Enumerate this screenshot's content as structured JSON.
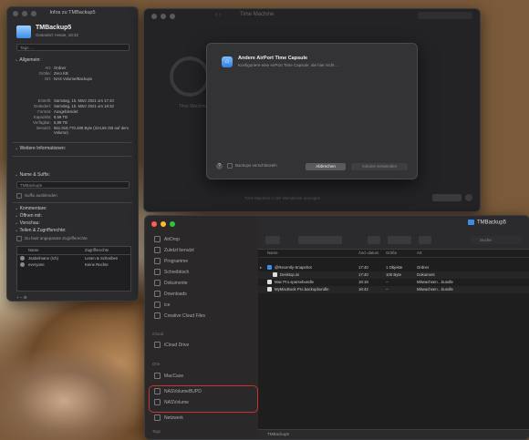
{
  "info": {
    "title": "Infos zu TMBackup5",
    "name": "TMBackup5",
    "subtitle": "Geändert: Heute, 18:32",
    "tags_placeholder": "Tags …",
    "sections": {
      "general": "Allgemein:",
      "more": "Weitere Informationen:",
      "name_ext": "Name & Suffix:",
      "comments": "Kommentare:",
      "open_with": "Öffnen mit:",
      "preview": "Vorschau:",
      "sharing": "Teilen & Zugriffsrechte:"
    },
    "kv": [
      {
        "k": "Art:",
        "v": "Ordner"
      },
      {
        "k": "Größe:",
        "v": "Zero KB"
      },
      {
        "k": "Ort:",
        "v": "NAS Volume/Backups"
      },
      {
        "k": "Erstellt:",
        "v": "Samstag, 15. März 2021 um 17:40"
      },
      {
        "k": "Geändert:",
        "v": "Samstag, 15. März 2021 um 18:32"
      },
      {
        "k": "Format:",
        "v": "Ausgeblendet"
      },
      {
        "k": "Kapazität:",
        "v": "8,58 TB"
      },
      {
        "k": "Verfügbar:",
        "v": "6,89 TB"
      },
      {
        "k": "Benutzt:",
        "v": "551.918.770.488 Byte (324,65 GB auf dem Volume)"
      }
    ],
    "name_value": "TMBackup5",
    "hide_ext": "Suffix ausblenden",
    "locked": "Geschützt",
    "sharing_note": "Du hast angepasste Zugriffsrechte",
    "perm_headers": [
      "Name",
      "Zugriffsrechte"
    ],
    "perms": [
      {
        "name": "Jsabelmann (Ich)",
        "right": "Lesen & Schreiben"
      },
      {
        "name": "everyone",
        "right": "Keine Rechte"
      }
    ],
    "bottom_buttons": "+  −  ⚙"
  },
  "timemachine": {
    "title": "Time Machine",
    "sidebar_label": "Time Machine",
    "footer": "Time Machine in der Menüleiste anzeigen",
    "done": "Fertig",
    "help": "?"
  },
  "sheet": {
    "icon": "⌂",
    "title": "Andere AirPort Time Capsule",
    "subtitle": "Konfiguriere eine AirPort Time Capsule, die hier nicht…",
    "help": "?",
    "checkbox": "Backups verschlüsseln",
    "cancel": "Abbrechen",
    "use_disk": "Volume verwenden"
  },
  "finder": {
    "title": "TMBackup5",
    "search_placeholder": "Suche",
    "sidebar": {
      "items_top": [
        "AirDrop",
        "Zuletzt benutzt",
        "Programme",
        "Schreibtisch",
        "Dokumente",
        "Downloads",
        "ice",
        "Creative Cloud Files"
      ],
      "head_icloud": "iCloud",
      "icloud": [
        "iCloud Drive"
      ],
      "head_ort": "Orte",
      "orte": [
        "MacCase",
        "NASVolumeBUPD",
        "NASVolume",
        "Netzwerk"
      ],
      "head_tags": "Tags"
    },
    "columns": [
      "Name",
      "Änd.-datum",
      "Größe",
      "Art"
    ],
    "rows": [
      {
        "name": "@Recently-Snapshot",
        "date": "17:40",
        "size": "1 Objekte",
        "kind": "Ordner",
        "folder": true,
        "disclosure": "▸"
      },
      {
        "name": "Desktop.ini",
        "date": "17:40",
        "size": "100 Byte",
        "kind": "Dokument",
        "folder": false,
        "disclosure": ""
      },
      {
        "name": "Mac Pro.sparsebundle",
        "date": "18:18",
        "size": "--",
        "kind": "Mitwachsen…bundle",
        "folder": false,
        "disclosure": ""
      },
      {
        "name": "MyMacBook Pro.backupbundle",
        "date": "18:42",
        "size": "--",
        "kind": "Mitwachsen…bundle",
        "folder": false,
        "disclosure": ""
      }
    ],
    "status": "TMBackup5"
  }
}
